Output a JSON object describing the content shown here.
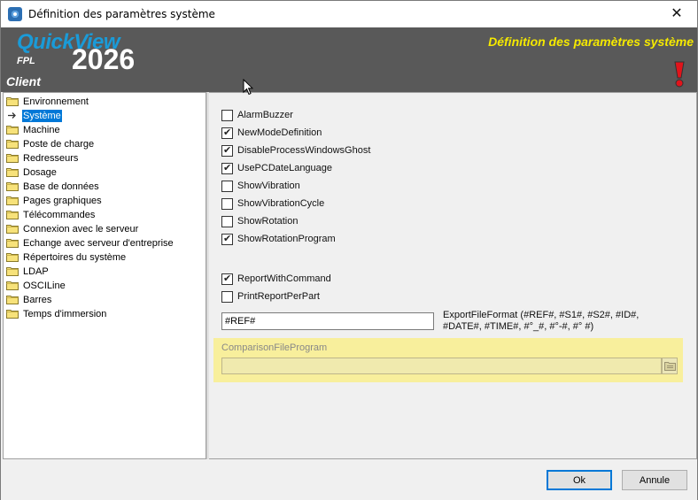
{
  "window": {
    "title": "Définition des paramètres système",
    "close_glyph": "✕",
    "icon": "app-icon"
  },
  "banner": {
    "brand_name": "QuickView",
    "brand_sub": "FPL",
    "year": "2026",
    "context": "Client",
    "title": "Définition des paramètres système",
    "title_color": "#f5e900",
    "brand_color": "#1a9bd8",
    "background": "#595959",
    "warning_icon": "exclamation-icon"
  },
  "tree": {
    "selected_index": 1,
    "selection_color": "#0078d7",
    "items": [
      {
        "label": "Environnement",
        "icon": "folder-icon"
      },
      {
        "label": "Système",
        "icon": "arrow-right-icon"
      },
      {
        "label": "Machine",
        "icon": "folder-icon"
      },
      {
        "label": "Poste de charge",
        "icon": "folder-icon"
      },
      {
        "label": "Redresseurs",
        "icon": "folder-icon"
      },
      {
        "label": "Dosage",
        "icon": "folder-icon"
      },
      {
        "label": "Base de données",
        "icon": "folder-icon"
      },
      {
        "label": "Pages graphiques",
        "icon": "folder-icon"
      },
      {
        "label": "Télécommandes",
        "icon": "folder-icon"
      },
      {
        "label": "Connexion avec le serveur",
        "icon": "folder-icon"
      },
      {
        "label": "Echange avec serveur d'entreprise",
        "icon": "folder-icon"
      },
      {
        "label": "Répertoires du système",
        "icon": "folder-icon"
      },
      {
        "label": "LDAP",
        "icon": "folder-icon"
      },
      {
        "label": "OSCILine",
        "icon": "folder-icon"
      },
      {
        "label": "Barres",
        "icon": "folder-icon"
      },
      {
        "label": "Temps d'immersion",
        "icon": "folder-icon"
      }
    ]
  },
  "settings": {
    "checkboxes": [
      {
        "label": "AlarmBuzzer",
        "checked": false
      },
      {
        "label": "NewModeDefinition",
        "checked": true
      },
      {
        "label": "DisableProcessWindowsGhost",
        "checked": true
      },
      {
        "label": "UsePCDateLanguage",
        "checked": true
      },
      {
        "label": "ShowVibration",
        "checked": false
      },
      {
        "label": "ShowVibrationCycle",
        "checked": false
      },
      {
        "label": "ShowRotation",
        "checked": false
      },
      {
        "label": "ShowRotationProgram",
        "checked": true
      },
      {
        "label": "ReportWithCommand",
        "checked": true
      },
      {
        "label": "PrintReportPerPart",
        "checked": false
      }
    ],
    "export_file_format": {
      "value": "#REF#",
      "label": "ExportFileFormat (#REF#, #S1#, #S2#, #ID#, #DATE#, #TIME#, #°_#, #°-#, #° #)"
    },
    "comparison_file_program": {
      "label": "ComparisonFileProgram",
      "value": "",
      "highlight_color": "#f8ef9c",
      "browse_icon": "folder-browse-icon"
    }
  },
  "footer": {
    "ok_label": "Ok",
    "cancel_label": "Annule"
  }
}
